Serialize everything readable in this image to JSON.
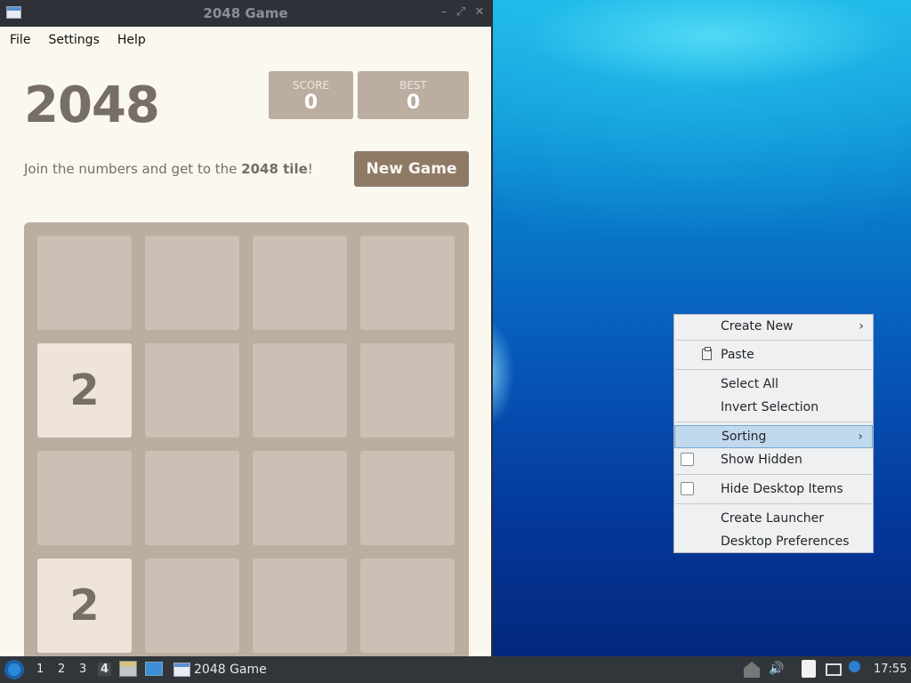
{
  "window": {
    "title": "2048 Game"
  },
  "menubar": {
    "items": [
      "File",
      "Settings",
      "Help"
    ]
  },
  "game": {
    "title": "2048",
    "score_label": "SCORE",
    "score_value": "0",
    "best_label": "BEST",
    "best_value": "0",
    "intro_prefix": "Join the numbers and get to the ",
    "intro_bold": "2048 tile",
    "intro_suffix": "!",
    "new_game_label": "New Game",
    "tiles": [
      {
        "row": 1,
        "col": 0,
        "value": "2"
      },
      {
        "row": 3,
        "col": 0,
        "value": "2"
      }
    ]
  },
  "context_menu": {
    "create_new": "Create New",
    "paste": "Paste",
    "select_all": "Select All",
    "invert_selection": "Invert Selection",
    "sorting": "Sorting",
    "show_hidden": "Show Hidden",
    "hide_desktop_items": "Hide Desktop Items",
    "create_launcher": "Create Launcher",
    "desktop_preferences": "Desktop Preferences",
    "submenu_arrow": "›"
  },
  "taskbar": {
    "workspaces": [
      "1",
      "2",
      "3",
      "4"
    ],
    "active_workspace": "4",
    "task_label": "2048 Game",
    "clock": "17:55"
  },
  "colors": {
    "board": "#bbada0",
    "tile_2": "#eee4da",
    "new_game_button": "#8f7a66",
    "menu_highlight": "#c1d9ed"
  }
}
